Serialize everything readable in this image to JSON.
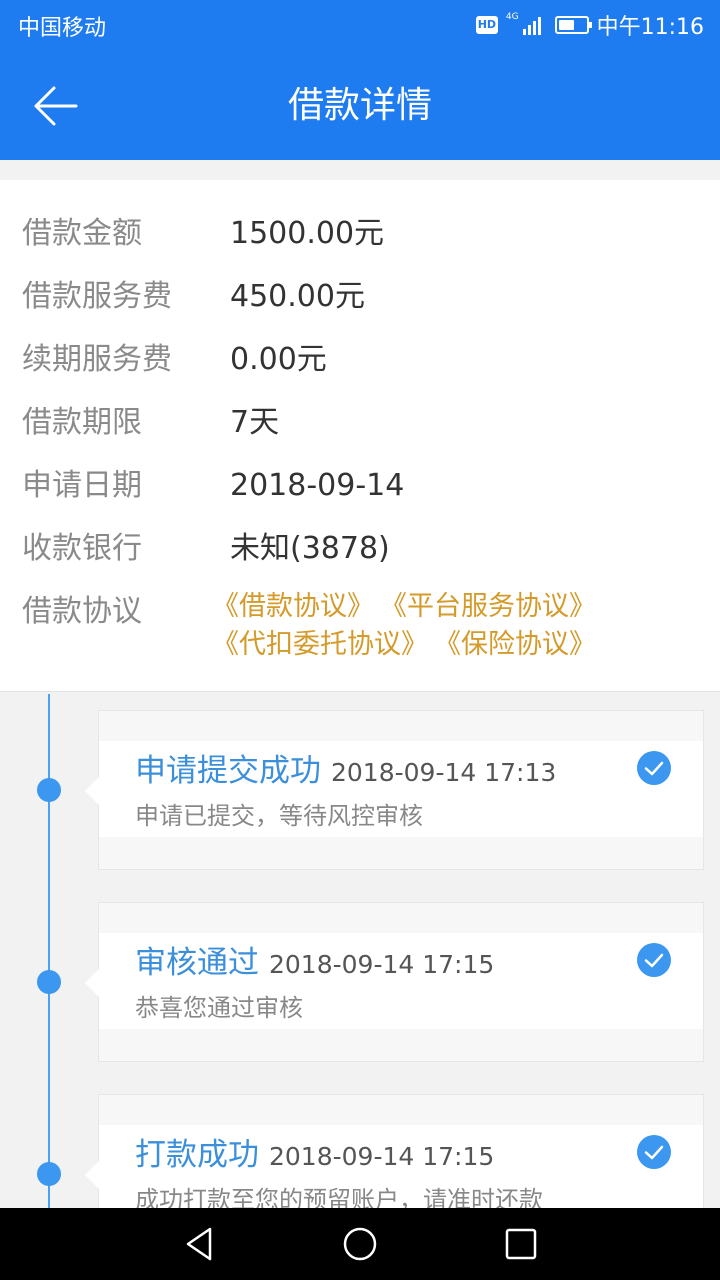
{
  "status": {
    "carrier": "中国移动",
    "hd": "HD",
    "network": "4G",
    "time": "中午11:16"
  },
  "header": {
    "title": "借款详情",
    "back_icon": "arrow-left-icon"
  },
  "details": [
    {
      "label": "借款金额",
      "value": "1500.00元"
    },
    {
      "label": "借款服务费",
      "value": "450.00元"
    },
    {
      "label": "续期服务费",
      "value": "0.00元"
    },
    {
      "label": "借款期限",
      "value": "7天"
    },
    {
      "label": "申请日期",
      "value": "2018-09-14"
    },
    {
      "label": "收款银行",
      "value": "未知(3878)"
    }
  ],
  "agreements": {
    "label": "借款协议",
    "items": [
      "《借款协议》",
      "《平台服务协议》",
      "《代扣委托协议》",
      "《保险协议》"
    ]
  },
  "timeline": [
    {
      "title": "申请提交成功",
      "time": "2018-09-14 17:13",
      "desc": "申请已提交，等待风控审核",
      "status_icon": "check-circle-icon"
    },
    {
      "title": "审核通过",
      "time": "2018-09-14 17:15",
      "desc": "恭喜您通过审核",
      "status_icon": "check-circle-icon"
    },
    {
      "title": "打款成功",
      "time": "2018-09-14 17:15",
      "desc": "成功打款至您的预留账户，请准时还款",
      "status_icon": "check-circle-icon"
    }
  ],
  "colors": {
    "primary": "#1e7cf0",
    "accent_link": "#d49a2a",
    "timeline": "#3b97f0"
  },
  "navbar": {
    "icons": [
      "back-triangle-icon",
      "home-circle-icon",
      "recents-square-icon"
    ]
  }
}
